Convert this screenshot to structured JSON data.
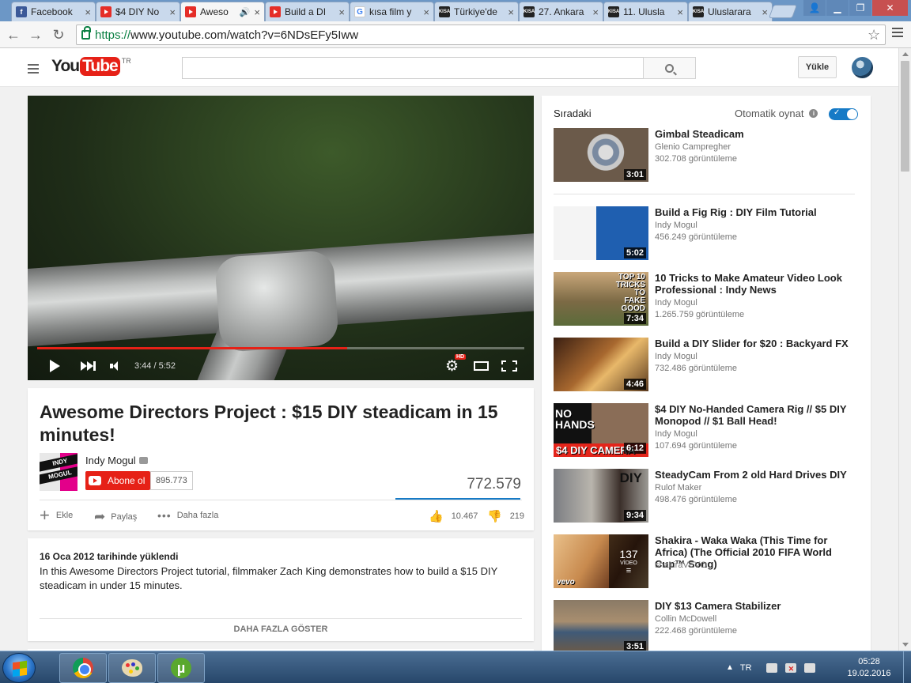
{
  "browser": {
    "tabs": [
      {
        "label": "Facebook",
        "favicon": "facebook-icon",
        "active": false
      },
      {
        "label": "$4 DIY No",
        "favicon": "youtube-icon",
        "active": false
      },
      {
        "label": "Aweso",
        "favicon": "youtube-icon",
        "active": true,
        "sound": "🔊"
      },
      {
        "label": "Build a DI",
        "favicon": "youtube-icon",
        "active": false
      },
      {
        "label": "kısa film y",
        "favicon": "google-icon",
        "active": false
      },
      {
        "label": "Türkiye'de",
        "favicon": "kisa-film-icon",
        "active": false
      },
      {
        "label": "27. Ankara",
        "favicon": "kisa-film-icon",
        "active": false
      },
      {
        "label": "11. Ulusla",
        "favicon": "kisa-film-icon",
        "active": false
      },
      {
        "label": "Uluslarara",
        "favicon": "kisa-film-icon",
        "active": false
      }
    ],
    "tab_close_glyph": "×",
    "favicon_kisa_text": "KISA",
    "favicon_google_text": "G",
    "url_scheme": "https://",
    "url_rest": "www.youtube.com/watch?v=6NDsEFy5Iww"
  },
  "youtube": {
    "logo_you": "You",
    "logo_tube": "Tube",
    "country_code": "TR",
    "search_placeholder": "",
    "upload_label": "Yükle"
  },
  "player": {
    "time": "3:44 / 5:52",
    "progress": 0.636,
    "hd_badge": "HD",
    "gear_glyph": "⚙"
  },
  "video": {
    "title": "Awesome Directors Project : $15 DIY steadicam in 15 minutes!",
    "channel_name": "Indy Mogul",
    "channel_logo_text_1": "INDY",
    "channel_logo_text_2": "MOGUL",
    "subscribe_label": "Abone ol",
    "subscriber_count": "895.773",
    "view_count": "772.579",
    "actions": {
      "add_label": "Ekle",
      "share_label": "Paylaş",
      "more_label": "Daha fazla",
      "likes": "10.467",
      "dislikes": "219"
    },
    "published": "16 Oca 2012 tarihinde yüklendi",
    "description": "In this Awesome Directors Project tutorial, filmmaker Zach King demonstrates how to build a $15 DIY steadicam in under 15 minutes.",
    "show_more_label": "DAHA FAZLA GÖSTER"
  },
  "sidebar": {
    "up_next_label": "Sıradaki",
    "autoplay_label": "Otomatik oynat",
    "autoplay_on": true,
    "info_glyph": "i",
    "toggle_glyph": "✓",
    "items": [
      {
        "title": "Gimbal Steadicam",
        "channel": "Glenio Campregher",
        "views": "302.708 görüntüleme",
        "duration": "3:01"
      },
      {
        "title": "Build a Fig Rig : DIY Film Tutorial",
        "channel": "Indy Mogul",
        "views": "456.249 görüntüleme",
        "duration": "5:02"
      },
      {
        "title": "10 Tricks to Make Amateur Video Look Professional : Indy News",
        "channel": "Indy Mogul",
        "views": "1.265.759 görüntüleme",
        "duration": "7:34",
        "thumb_text": "TOP 10 TRICKS TO FAKE GOOD"
      },
      {
        "title": "Build a DIY Slider for $20 : Backyard FX",
        "channel": "Indy Mogul",
        "views": "732.486 görüntüleme",
        "duration": "4:46"
      },
      {
        "title": "$4 DIY No-Handed Camera Rig // $5 DIY Monopod // $1 Ball Head!",
        "channel": "Indy Mogul",
        "views": "107.694 görüntüleme",
        "duration": "6:12",
        "thumb_text_1": "NO HANDS",
        "thumb_text_2": "$4 DIY CAMERA"
      },
      {
        "title": "SteadyCam From 2 old Hard Drives DIY",
        "channel": "Rulof Maker",
        "views": "498.476 görüntüleme",
        "duration": "9:34",
        "thumb_text": "DIY"
      },
      {
        "title": "Shakira - Waka Waka (This Time for Africa) (The Official 2010 FIFA World Cup™ Song)",
        "channel": "shakiraVEVO",
        "views": "",
        "playlist_count": "137",
        "playlist_label": "VİDEO",
        "thumb_text": "vevo"
      },
      {
        "title": "DIY $13 Camera Stabilizer",
        "channel": "Collin McDowell",
        "views": "222.468 görüntüleme",
        "duration": "3:51"
      }
    ]
  },
  "taskbar": {
    "lang": "TR",
    "time": "05:28",
    "date": "19.02.2016",
    "utorrent_glyph": "µ"
  },
  "colors": {
    "youtube_red": "#e62117",
    "accent_blue": "#167ac6",
    "secure_green": "#0b8043"
  }
}
